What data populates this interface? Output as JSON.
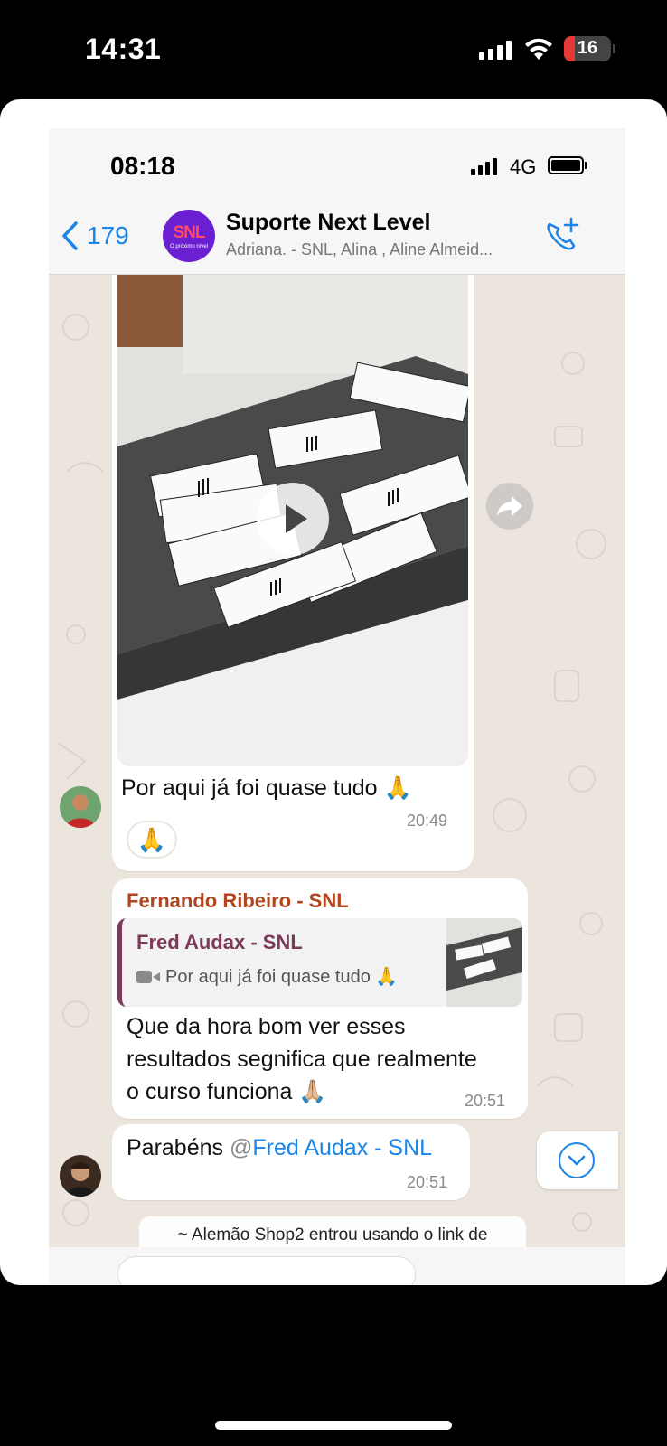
{
  "outer_status": {
    "time": "14:31",
    "battery": "16"
  },
  "inner_status": {
    "time": "08:18",
    "network": "4G"
  },
  "header": {
    "back_count": "179",
    "title": "Suporte Next Level",
    "members": "Adriana. - SNL, Alina , Aline Almeid...",
    "avatar_logo": "SNL",
    "avatar_sub": "O próximo nível"
  },
  "messages": {
    "video": {
      "caption": "Por aqui já foi quase tudo 🙏",
      "time": "20:49",
      "reaction": "🙏"
    },
    "reply": {
      "sender": "Fernando Ribeiro - SNL",
      "quoted_sender": "Fred Audax - SNL",
      "quoted_text": "Por aqui já foi quase tudo 🙏",
      "text_line1": "Que da hora bom ver esses",
      "text_line2": "resultados segnifica que realmente",
      "text_line3": "o curso funciona 🙏🏼",
      "time": "20:51"
    },
    "mention": {
      "prefix": "Parabéns ",
      "at": "@",
      "mention": "Fred Audax - SNL",
      "time": "20:51"
    },
    "system": "~ Alemão Shop2 entrou usando o link de"
  },
  "icons": {
    "back": "chevron-left-icon",
    "call_add": "phone-plus-icon",
    "play": "play-icon",
    "forward": "forward-icon",
    "scroll_down": "chevron-down-icon",
    "video_cam": "video-camera-icon"
  },
  "colors": {
    "accent": "#1a85e6",
    "sender": "#b0451f",
    "quoted_sender": "#7a3b5a",
    "chat_bg": "#ece5dd"
  }
}
